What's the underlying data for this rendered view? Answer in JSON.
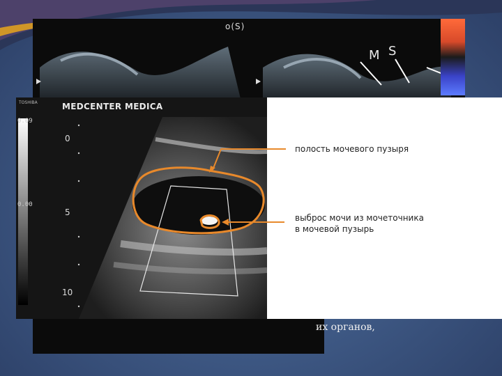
{
  "back_image": {
    "mode_label": "o(S)",
    "label_m": "M",
    "label_s": "S",
    "lower_text": "их органов,"
  },
  "front_image": {
    "vendor": "TOSHIBA",
    "brand": "MEDCENTER MEDICA",
    "scale_top": "0.09",
    "scale_mid": "0.00",
    "depth_marks": [
      "0",
      "5",
      "10"
    ]
  },
  "annotations": {
    "bladder_cavity": "полость мочевого пузыря",
    "ureter_jet_line1": "выброс мочи из мочеточника",
    "ureter_jet_line2": "в мочевой пузырь"
  },
  "colors": {
    "annotation_line": "#e8892b",
    "slide_background": "#3f5a86"
  }
}
